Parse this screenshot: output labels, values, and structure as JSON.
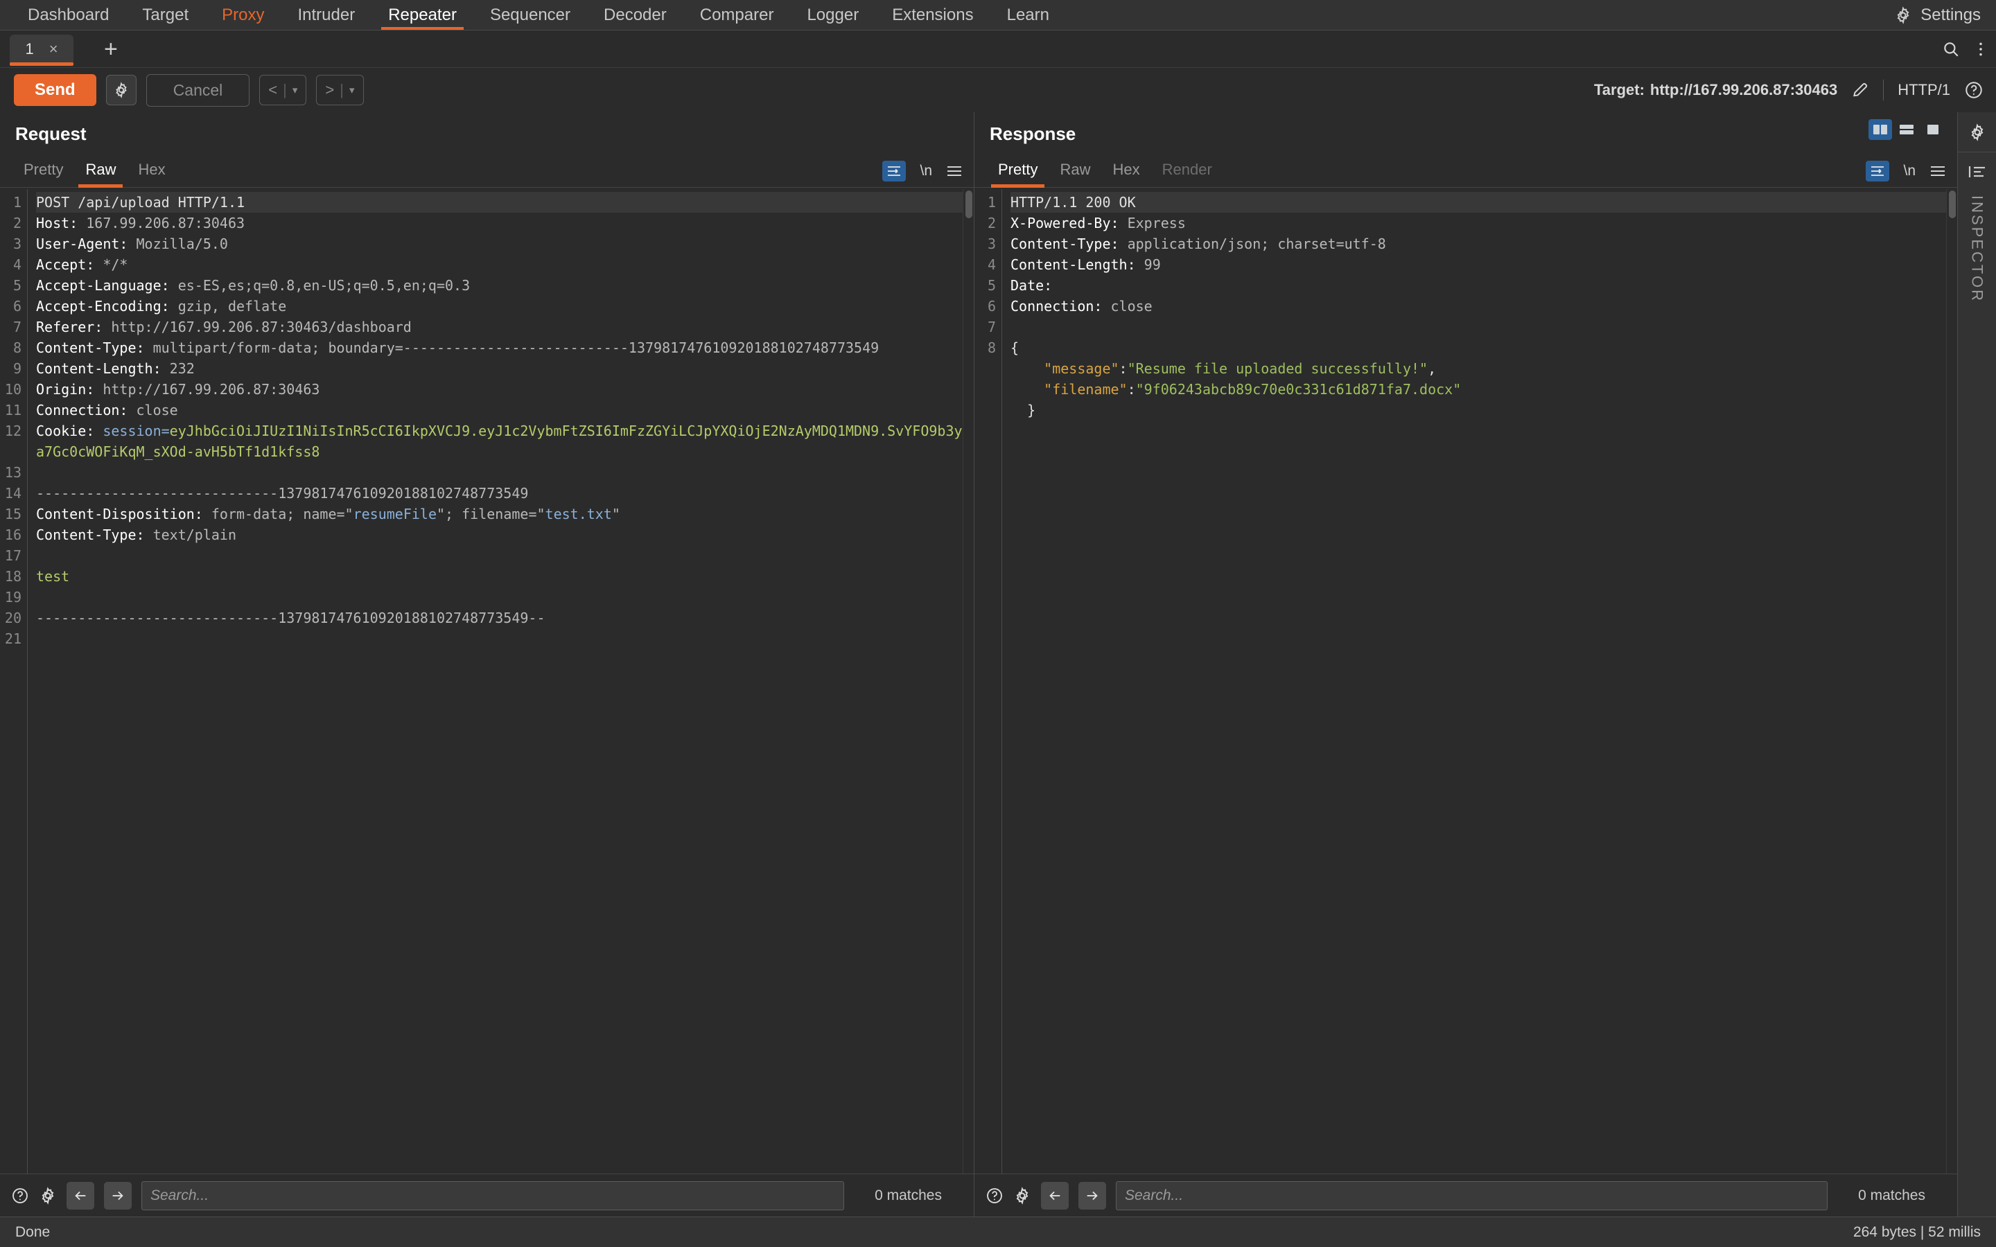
{
  "topnav": {
    "items": [
      {
        "label": "Dashboard",
        "state": "normal"
      },
      {
        "label": "Target",
        "state": "normal"
      },
      {
        "label": "Proxy",
        "state": "highlight"
      },
      {
        "label": "Intruder",
        "state": "normal"
      },
      {
        "label": "Repeater",
        "state": "active"
      },
      {
        "label": "Sequencer",
        "state": "normal"
      },
      {
        "label": "Decoder",
        "state": "normal"
      },
      {
        "label": "Comparer",
        "state": "normal"
      },
      {
        "label": "Logger",
        "state": "normal"
      },
      {
        "label": "Extensions",
        "state": "normal"
      },
      {
        "label": "Learn",
        "state": "normal"
      }
    ],
    "settings_label": "Settings",
    "accent_color": "#e8662b"
  },
  "tabstrip": {
    "tabs": [
      {
        "label": "1",
        "close": "×"
      }
    ],
    "add_label": "+"
  },
  "actionbar": {
    "send_label": "Send",
    "cancel_label": "Cancel",
    "back_label": "<",
    "forward_label": ">",
    "caret": "▾",
    "target_label": "Target:",
    "target_url": "http://167.99.206.87:30463",
    "http_version": "HTTP/1"
  },
  "request": {
    "title": "Request",
    "tabs": [
      {
        "label": "Pretty",
        "state": "inactive"
      },
      {
        "label": "Raw",
        "state": "active"
      },
      {
        "label": "Hex",
        "state": "inactive"
      }
    ],
    "newline_label": "\\n",
    "lines": [
      {
        "n": "1",
        "parts": [
          {
            "t": "POST /api/upload HTTP/1.1",
            "c": "plainw"
          }
        ]
      },
      {
        "n": "2",
        "parts": [
          {
            "t": "Host: ",
            "c": "hdr-name"
          },
          {
            "t": "167.99.206.87:30463",
            "c": "hdr-val"
          }
        ]
      },
      {
        "n": "3",
        "parts": [
          {
            "t": "User-Agent: ",
            "c": "hdr-name"
          },
          {
            "t": "Mozilla/5.0",
            "c": "hdr-val"
          }
        ]
      },
      {
        "n": "4",
        "parts": [
          {
            "t": "Accept: ",
            "c": "hdr-name"
          },
          {
            "t": "*/*",
            "c": "hdr-val"
          }
        ]
      },
      {
        "n": "5",
        "parts": [
          {
            "t": "Accept-Language: ",
            "c": "hdr-name"
          },
          {
            "t": "es-ES,es;q=0.8,en-US;q=0.5,en;q=0.3",
            "c": "hdr-val"
          }
        ]
      },
      {
        "n": "6",
        "parts": [
          {
            "t": "Accept-Encoding: ",
            "c": "hdr-name"
          },
          {
            "t": "gzip, deflate",
            "c": "hdr-val"
          }
        ]
      },
      {
        "n": "7",
        "parts": [
          {
            "t": "Referer: ",
            "c": "hdr-name"
          },
          {
            "t": "http://167.99.206.87:30463/dashboard",
            "c": "hdr-val"
          }
        ]
      },
      {
        "n": "8",
        "parts": [
          {
            "t": "Content-Type: ",
            "c": "hdr-name"
          },
          {
            "t": "multipart/form-data; boundary=---------------------------137981747610920188102748773549",
            "c": "hdr-val"
          }
        ]
      },
      {
        "n": "9",
        "parts": [
          {
            "t": "Content-Length: ",
            "c": "hdr-name"
          },
          {
            "t": "232",
            "c": "hdr-val"
          }
        ]
      },
      {
        "n": "10",
        "parts": [
          {
            "t": "Origin: ",
            "c": "hdr-name"
          },
          {
            "t": "http://167.99.206.87:30463",
            "c": "hdr-val"
          }
        ]
      },
      {
        "n": "11",
        "parts": [
          {
            "t": "Connection: ",
            "c": "hdr-name"
          },
          {
            "t": "close",
            "c": "hdr-val"
          }
        ]
      },
      {
        "n": "12",
        "parts": [
          {
            "t": "Cookie: ",
            "c": "hdr-name"
          },
          {
            "t": "session=",
            "c": "blue"
          },
          {
            "t": "eyJhbGciOiJIUzI1NiIsInR5cCI6IkpXVCJ9.eyJ1c2VybmFtZSI6ImFzZGYiLCJpYXQiOjE2NzAyMDQ1MDN9.SvYFO9b3ya7Gc0cWOFiKqM_sXOd-avH5bTf1d1kfss8",
            "c": "jwt"
          }
        ]
      },
      {
        "n": "13",
        "parts": []
      },
      {
        "n": "14",
        "parts": [
          {
            "t": "-----------------------------137981747610920188102748773549",
            "c": "dash"
          }
        ]
      },
      {
        "n": "15",
        "parts": [
          {
            "t": "Content-Disposition: ",
            "c": "hdr-name"
          },
          {
            "t": "form-data; name=\"",
            "c": "hdr-val"
          },
          {
            "t": "resumeFile",
            "c": "blue"
          },
          {
            "t": "\"; filename=\"",
            "c": "hdr-val"
          },
          {
            "t": "test.txt",
            "c": "blue"
          },
          {
            "t": "\"",
            "c": "hdr-val"
          }
        ]
      },
      {
        "n": "16",
        "parts": [
          {
            "t": "Content-Type: ",
            "c": "hdr-name"
          },
          {
            "t": "text/plain",
            "c": "hdr-val"
          }
        ]
      },
      {
        "n": "17",
        "parts": []
      },
      {
        "n": "18",
        "parts": [
          {
            "t": "test",
            "c": "str-green"
          }
        ]
      },
      {
        "n": "19",
        "parts": []
      },
      {
        "n": "20",
        "parts": [
          {
            "t": "-----------------------------137981747610920188102748773549--",
            "c": "dash"
          }
        ]
      },
      {
        "n": "21",
        "parts": []
      }
    ],
    "search_placeholder": "Search...",
    "matches_label": "0 matches"
  },
  "response": {
    "title": "Response",
    "tabs": [
      {
        "label": "Pretty",
        "state": "active"
      },
      {
        "label": "Raw",
        "state": "inactive"
      },
      {
        "label": "Hex",
        "state": "inactive"
      },
      {
        "label": "Render",
        "state": "disabled"
      }
    ],
    "newline_label": "\\n",
    "lines": [
      {
        "n": "1",
        "parts": [
          {
            "t": "HTTP/1.1 200 OK",
            "c": "plainw"
          }
        ]
      },
      {
        "n": "2",
        "parts": [
          {
            "t": "X-Powered-By: ",
            "c": "hdr-name"
          },
          {
            "t": "Express",
            "c": "hdr-val"
          }
        ]
      },
      {
        "n": "3",
        "parts": [
          {
            "t": "Content-Type: ",
            "c": "hdr-name"
          },
          {
            "t": "application/json; charset=utf-8",
            "c": "hdr-val"
          }
        ]
      },
      {
        "n": "4",
        "parts": [
          {
            "t": "Content-Length: ",
            "c": "hdr-name"
          },
          {
            "t": "99",
            "c": "hdr-val"
          }
        ]
      },
      {
        "n": "5",
        "parts": [
          {
            "t": "Date:",
            "c": "hdr-name"
          }
        ]
      },
      {
        "n": "6",
        "parts": [
          {
            "t": "Connection: ",
            "c": "hdr-name"
          },
          {
            "t": "close",
            "c": "hdr-val"
          }
        ]
      },
      {
        "n": "7",
        "parts": []
      },
      {
        "n": "8",
        "parts": [
          {
            "t": "{",
            "c": "plainw"
          }
        ]
      },
      {
        "n": "",
        "parts": [
          {
            "t": "    \"message\"",
            "c": "key-orange"
          },
          {
            "t": ":",
            "c": "plainw"
          },
          {
            "t": "\"Resume file uploaded successfully!\"",
            "c": "val-green"
          },
          {
            "t": ",",
            "c": "plainw"
          }
        ]
      },
      {
        "n": "",
        "parts": [
          {
            "t": "    \"filename\"",
            "c": "key-orange"
          },
          {
            "t": ":",
            "c": "plainw"
          },
          {
            "t": "\"9f06243abcb89c70e0c331c61d871fa7.docx\"",
            "c": "val-green"
          }
        ]
      },
      {
        "n": "",
        "parts": [
          {
            "t": "  }",
            "c": "plainw"
          }
        ]
      }
    ],
    "search_placeholder": "Search...",
    "matches_label": "0 matches",
    "layout_buttons": [
      {
        "name": "side-by-side",
        "selected": true
      },
      {
        "name": "stacked",
        "selected": false
      },
      {
        "name": "single",
        "selected": false
      }
    ]
  },
  "rail": {
    "inspector_label": "INSPECTOR"
  },
  "statusbar": {
    "status": "Done",
    "metrics": "264 bytes | 52 millis"
  }
}
